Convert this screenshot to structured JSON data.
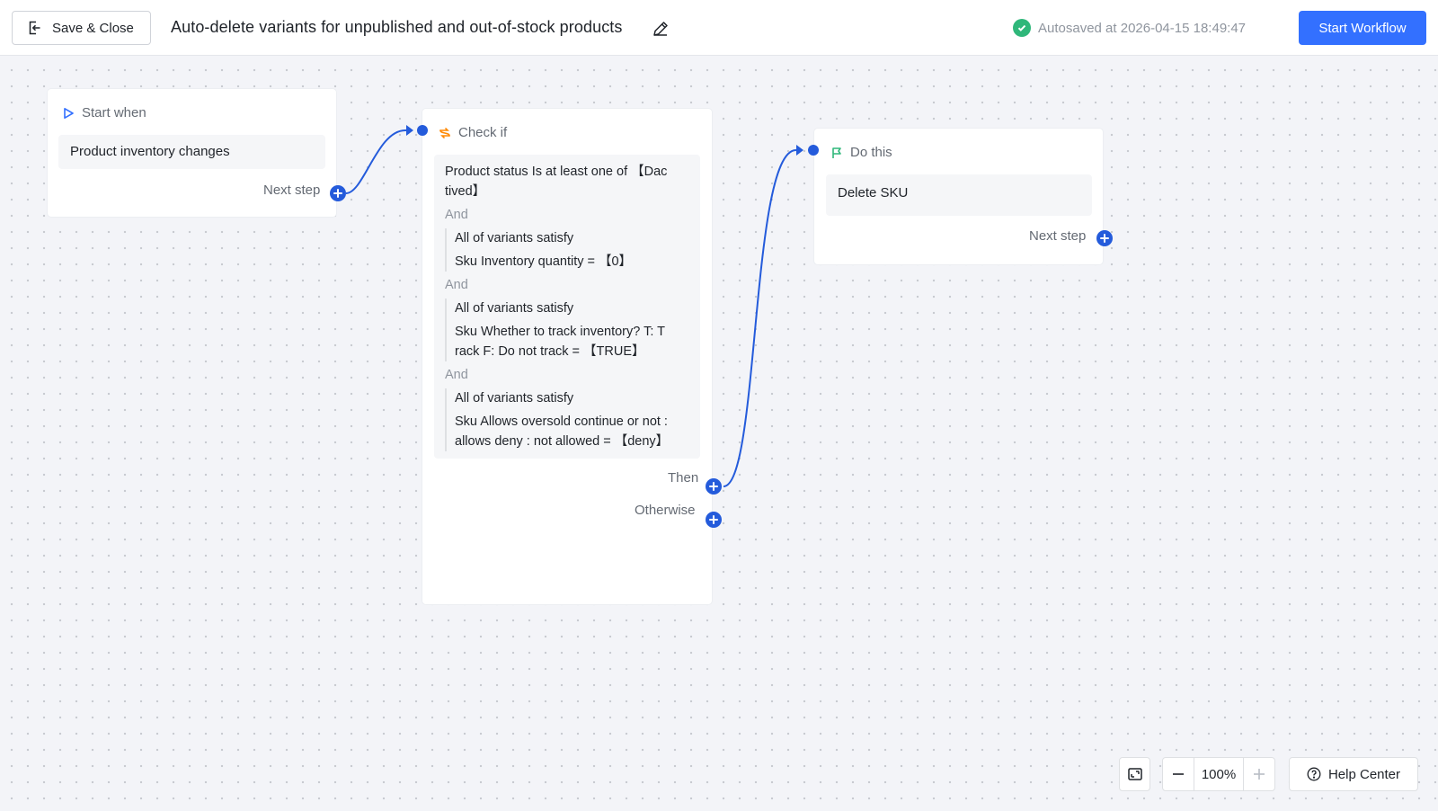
{
  "header": {
    "save_close_label": "Save & Close",
    "title": "Auto-delete variants for unpublished and out-of-stock products",
    "autosave_text": "Autosaved at 2026-04-15 18:49:47",
    "start_button_label": "Start Workflow"
  },
  "trigger_node": {
    "header": "Start when",
    "value": "Product inventory changes",
    "port_label": "Next step"
  },
  "condition_node": {
    "header": "Check if",
    "first_condition_line1": "Product status Is at least one of 【Dac",
    "first_condition_line2": "tived】",
    "and_label": "And",
    "groups": [
      {
        "title": "All of variants satisfy",
        "line1": "Sku Inventory quantity = 【0】",
        "line2": ""
      },
      {
        "title": "All of variants satisfy",
        "line1": "Sku Whether to track inventory? T: T",
        "line2": "rack F: Do not track = 【TRUE】"
      },
      {
        "title": "All of variants satisfy",
        "line1": "Sku Allows oversold continue or not :",
        "line2": "allows deny : not allowed = 【deny】"
      }
    ],
    "then_label": "Then",
    "otherwise_label": "Otherwise"
  },
  "action_node": {
    "header": "Do this",
    "value": "Delete SKU",
    "port_label": "Next step"
  },
  "toolbar": {
    "zoom_level": "100%",
    "help_label": "Help Center"
  },
  "colors": {
    "primary": "#3370ff",
    "connector": "#245bdb",
    "success": "#2fb77a",
    "condition_icon": "#ff8800",
    "action_icon": "#2fb77a"
  },
  "icons": {
    "save_close": "exit-icon",
    "edit": "pencil-icon",
    "autosave": "check-circle-icon",
    "trigger": "play-icon",
    "condition": "branch-icon",
    "action": "flag-icon",
    "fit_view": "fit-view-icon",
    "zoom_out": "minus-icon",
    "zoom_in": "plus-icon",
    "help": "question-icon"
  }
}
